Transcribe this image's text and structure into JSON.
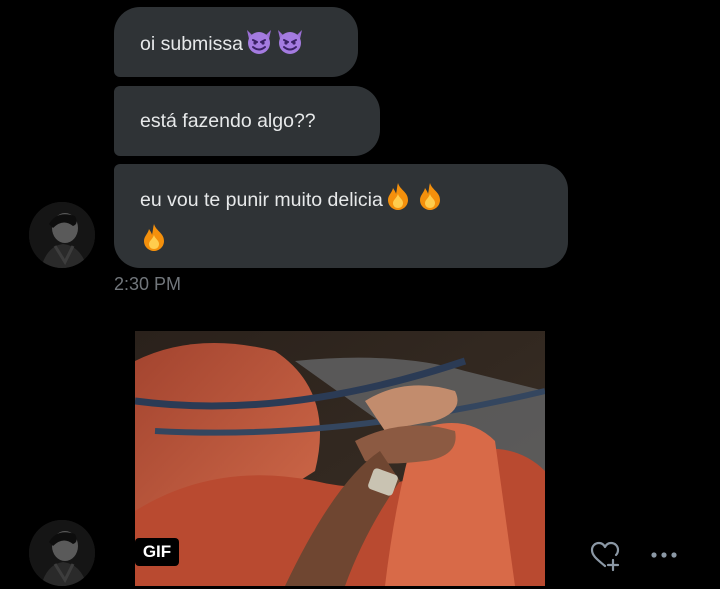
{
  "messages": [
    {
      "text": "oi submissa",
      "emojis": [
        "smiling-devil-icon",
        "smiling-devil-icon"
      ]
    },
    {
      "text": "está fazendo algo??",
      "emojis": []
    },
    {
      "text": "eu vou te punir muito delicia",
      "emojis": [
        "fire-icon",
        "fire-icon",
        "fire-icon"
      ]
    }
  ],
  "timestamp": "2:30 PM",
  "media": {
    "badge": "GIF"
  },
  "actions": {
    "react_icon": "heart-plus-icon",
    "more_icon": "more-dots-icon"
  },
  "colors": {
    "background": "#000000",
    "bubble": "#2f3336",
    "text": "#e7e9ea",
    "muted": "#71767b"
  }
}
